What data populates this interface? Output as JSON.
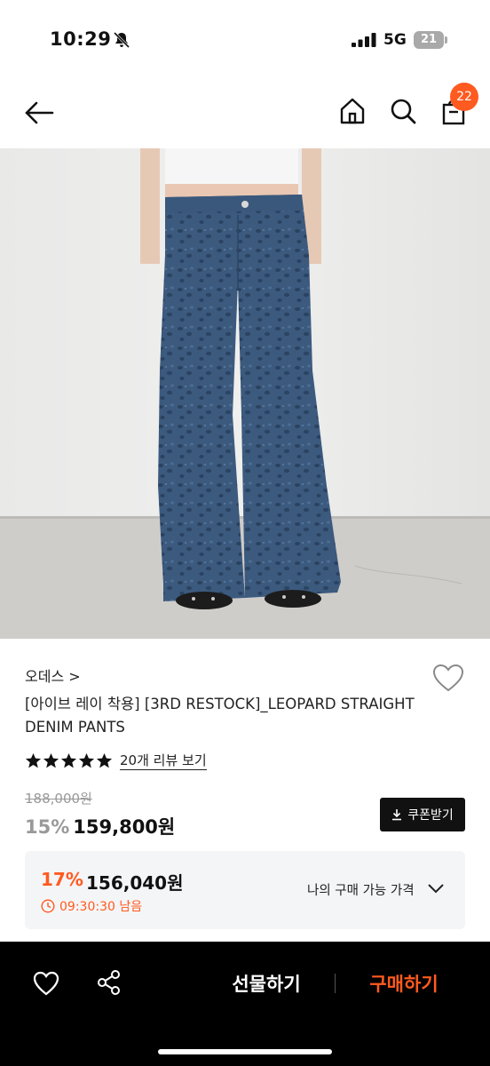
{
  "status_bar": {
    "time": "10:29",
    "network": "5G",
    "battery": "21"
  },
  "nav": {
    "cart_count": "22"
  },
  "product": {
    "brand": "오데스 >",
    "title": "[아이브 레이 착용] [3RD RESTOCK]_LEOPARD STRAIGHT DENIM PANTS",
    "rating": 5,
    "review_link": "20개 리뷰 보기",
    "original_price": "188,000원",
    "discount_rate": "15%",
    "sale_price": "159,800원",
    "coupon_label": "쿠폰받기"
  },
  "special_offer": {
    "discount_rate": "17%",
    "price": "156,040원",
    "timer": "09:30:30 남음",
    "my_price_label": "나의 구매 가능 가격"
  },
  "bottom_bar": {
    "gift_label": "선물하기",
    "buy_label": "구매하기"
  },
  "colors": {
    "accent": "#ff5a1f",
    "bottom_bar": "#000000"
  }
}
